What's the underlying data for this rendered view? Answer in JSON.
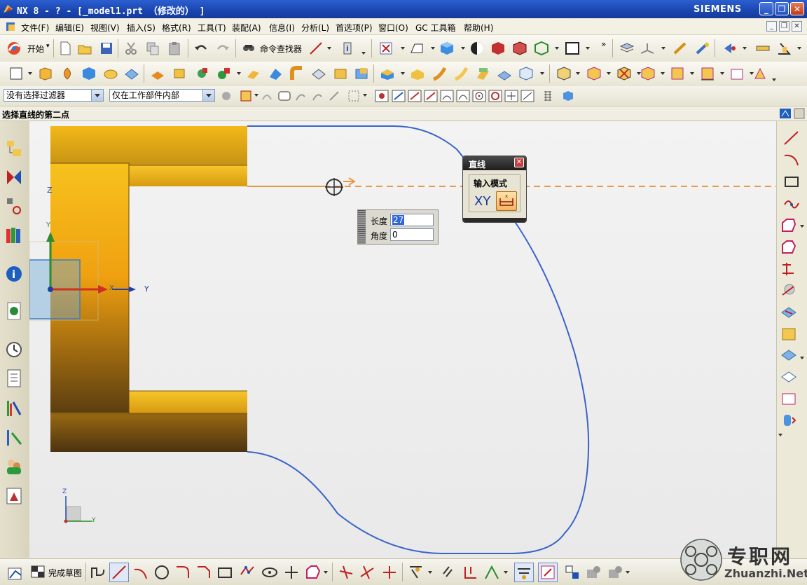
{
  "titlebar": {
    "title": "NX 8 - ? - [_model1.prt （修改的） ]",
    "brand": "SIEMENS",
    "buttons": [
      "_",
      "❐",
      "✕"
    ]
  },
  "menubar": {
    "items": [
      "文件(F)",
      "编辑(E)",
      "视图(V)",
      "插入(S)",
      "格式(R)",
      "工具(T)",
      "装配(A)",
      "信息(I)",
      "分析(L)",
      "首选项(P)",
      "窗口(O)",
      "GC 工具箱",
      "帮助(H)"
    ]
  },
  "toolbar_standard": {
    "start_label": "开始",
    "start_suffix": "▾",
    "command_finder_label": "命令查找器",
    "more_glyph": "»"
  },
  "selection_bar": {
    "filter_value": "没有选择过滤器",
    "scope_value": "仅在工作部件内部"
  },
  "status": {
    "prompt": "选择直线的第二点"
  },
  "line_dialog": {
    "title": "直线",
    "close_glyph": "✕",
    "group_label": "输入模式",
    "xy_label": "XY"
  },
  "dynamic_input": {
    "length_label": "长度",
    "length_value": "27",
    "angle_label": "角度",
    "angle_value": "0"
  },
  "sketch_toolbar": {
    "finish_label": "完成草图"
  },
  "triad": {
    "x_label": "X",
    "y_label": "Y",
    "y_label_2": "Y",
    "z_label": "Z",
    "wcs_z_label": "Z",
    "wcs_y_label": "Y"
  },
  "watermark": {
    "name": "专职网",
    "url": "Zhuanzhi.Net"
  },
  "colors": {
    "sketch_curve": "#3a63c8",
    "rubberband": "#e89a4a",
    "solid_gold": "#f1b51a",
    "title_blue": "#1a45b0"
  }
}
